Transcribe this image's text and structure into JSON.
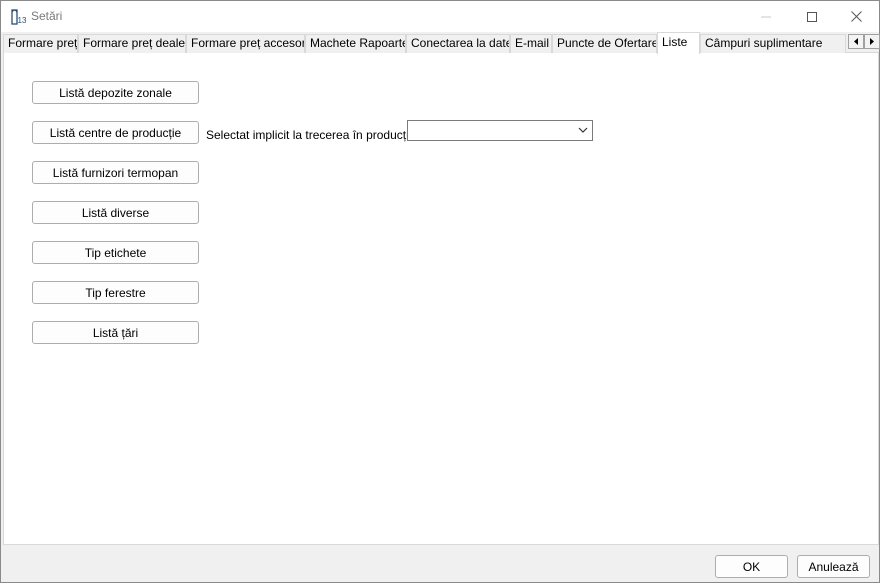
{
  "window": {
    "title": "Setări",
    "app_icon": "ferestre-app-icon"
  },
  "tabs": [
    {
      "label": "Formare preț",
      "active": false
    },
    {
      "label": "Formare preț dealer",
      "active": false
    },
    {
      "label": "Formare preț accesorii",
      "active": false
    },
    {
      "label": "Machete Rapoarte",
      "active": false
    },
    {
      "label": "Conectarea la date",
      "active": false
    },
    {
      "label": "E-mail",
      "active": false
    },
    {
      "label": "Puncte de Ofertare",
      "active": false
    },
    {
      "label": "Liste",
      "active": true
    },
    {
      "label": "Câmpuri suplimentare",
      "active": false
    }
  ],
  "list_buttons": [
    "Listă depozite zonale",
    "Listă centre de producție",
    "Listă furnizori termopan",
    "Listă diverse",
    "Tip etichete",
    "Tip ferestre",
    "Listă țări"
  ],
  "default_production": {
    "label": "Selectat implicit la trecerea în producție",
    "value": ""
  },
  "footer": {
    "ok_label": "OK",
    "cancel_label": "Anulează"
  }
}
